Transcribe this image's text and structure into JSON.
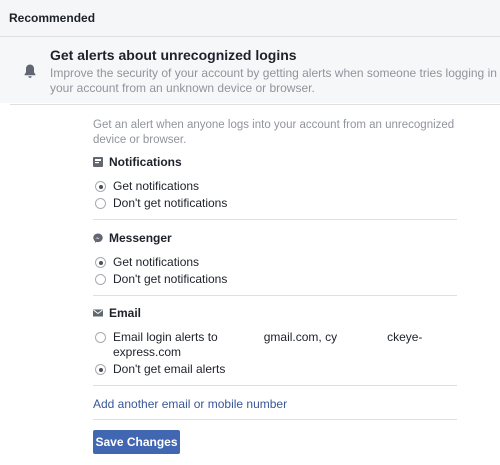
{
  "header": {
    "title": "Recommended"
  },
  "alert": {
    "title": "Get alerts about unrecognized logins",
    "description": "Improve the security of your account by getting alerts when someone tries logging in to your account from an unknown device or browser.",
    "icon": "bell-icon"
  },
  "intro_text": "Get an alert when anyone logs into your account from an unrecognized device or browser.",
  "sections": {
    "notifications": {
      "title": "Notifications",
      "icon": "notifications-icon",
      "options": [
        {
          "label": "Get notifications",
          "checked": true
        },
        {
          "label": "Don't get notifications",
          "checked": false
        }
      ]
    },
    "messenger": {
      "title": "Messenger",
      "icon": "messenger-icon",
      "options": [
        {
          "label": "Get notifications",
          "checked": true
        },
        {
          "label": "Don't get notifications",
          "checked": false
        }
      ]
    },
    "email": {
      "title": "Email",
      "icon": "envelope-icon",
      "options": [
        {
          "label_prefix": "Email login alerts to",
          "label_mid": "gmail.com, cy",
          "label_suffix": "ckeye-express.com",
          "checked": false
        },
        {
          "label": "Don't get email alerts",
          "checked": true
        }
      ]
    }
  },
  "add_contact_link": "Add another email or mobile number",
  "save_button": "Save Changes",
  "colors": {
    "accent": "#4267b2",
    "link": "#385898",
    "muted": "#90949c"
  }
}
